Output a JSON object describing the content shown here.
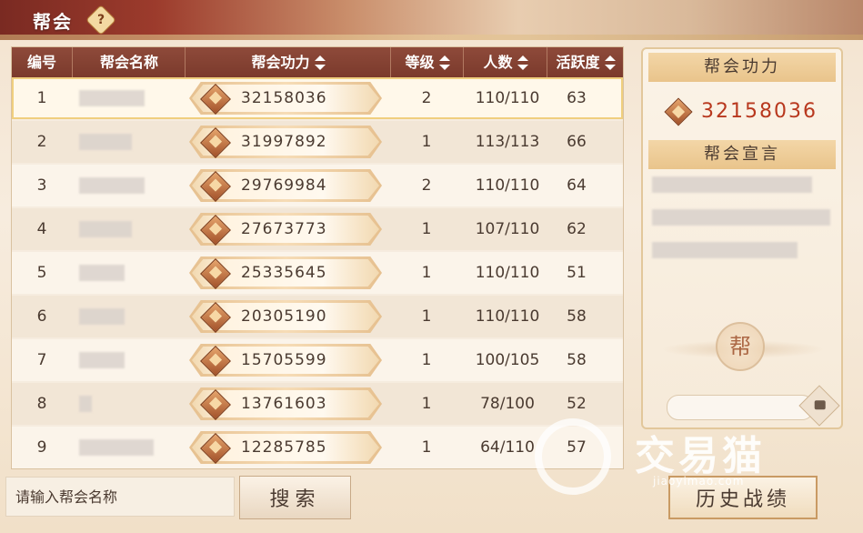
{
  "header": {
    "title": "帮会",
    "help_label": "?"
  },
  "table": {
    "columns": [
      {
        "label": "编号",
        "sortable": false
      },
      {
        "label": "帮会名称",
        "sortable": false
      },
      {
        "label": "帮会功力",
        "sortable": true
      },
      {
        "label": "等级",
        "sortable": true
      },
      {
        "label": "人数",
        "sortable": true
      },
      {
        "label": "活跃度",
        "sortable": true
      }
    ],
    "rows": [
      {
        "idx": "1",
        "power": "32158036",
        "level": "2",
        "members": "110/110",
        "activity": "63",
        "selected": true
      },
      {
        "idx": "2",
        "power": "31997892",
        "level": "1",
        "members": "113/113",
        "activity": "66"
      },
      {
        "idx": "3",
        "power": "29769984",
        "level": "2",
        "members": "110/110",
        "activity": "64"
      },
      {
        "idx": "4",
        "power": "27673773",
        "level": "1",
        "members": "107/110",
        "activity": "62"
      },
      {
        "idx": "5",
        "power": "25335645",
        "level": "1",
        "members": "110/110",
        "activity": "51"
      },
      {
        "idx": "6",
        "power": "20305190",
        "level": "1",
        "members": "110/110",
        "activity": "58"
      },
      {
        "idx": "7",
        "power": "15705599",
        "level": "1",
        "members": "100/105",
        "activity": "58"
      },
      {
        "idx": "8",
        "power": "13761603",
        "level": "1",
        "members": "78/100",
        "activity": "52"
      },
      {
        "idx": "9",
        "power": "12285785",
        "level": "1",
        "members": "64/110",
        "activity": "57"
      }
    ]
  },
  "search": {
    "placeholder": "请输入帮会名称",
    "button_label": "搜索"
  },
  "side_panel": {
    "power_heading": "帮会功力",
    "power_value": "32158036",
    "declaration_heading": "帮会宣言",
    "emblem_char": "帮"
  },
  "history_button": "历史战绩",
  "watermark": {
    "text": "交易猫",
    "url": "jiaoyimao.com"
  },
  "colors": {
    "header_bg": "#7b3a2c",
    "power_text": "#b8381e",
    "accent_gold": "#e9c48b"
  }
}
